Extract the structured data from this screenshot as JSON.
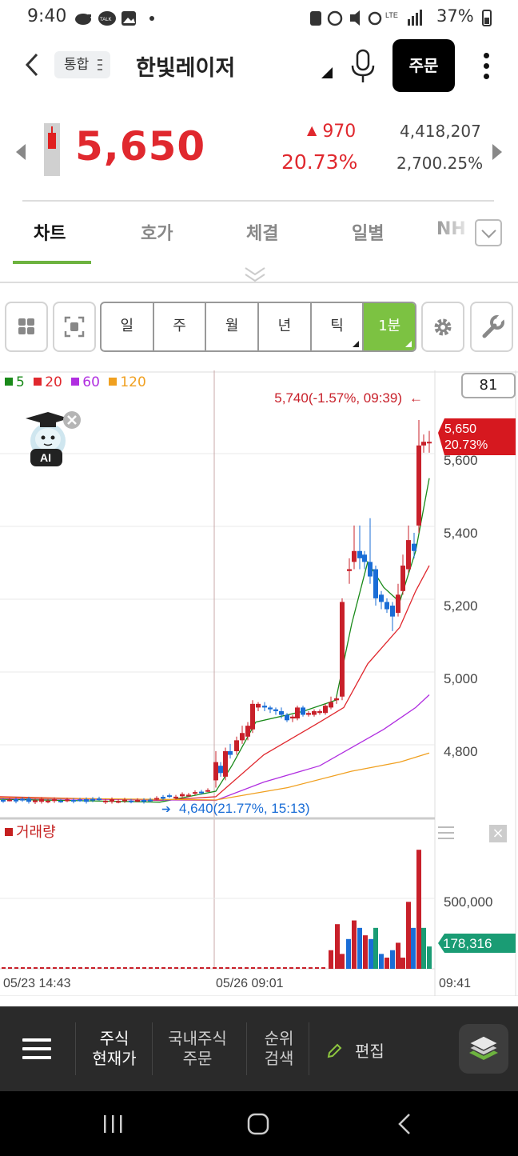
{
  "status_bar": {
    "time": "9:40",
    "left_icons": [
      "piggy-bank-icon",
      "kakaotalk-icon",
      "image-icon",
      "dot-icon"
    ],
    "talk_label": "TALK",
    "lte_label": "LTE",
    "battery": "37%"
  },
  "header": {
    "tag": "통합",
    "stock_name": "한빛레이저",
    "order_label": "주문"
  },
  "quote": {
    "price": "5,650",
    "change": "970",
    "change_pct": "20.73%",
    "volume": "4,418,207",
    "volume_pct": "2,700.25%"
  },
  "tabs": [
    {
      "label": "차트",
      "active": true
    },
    {
      "label": "호가"
    },
    {
      "label": "체결"
    },
    {
      "label": "일별"
    },
    {
      "label": "NH"
    }
  ],
  "toolbar": {
    "periods": [
      "일",
      "주",
      "월",
      "년",
      "틱",
      "1분"
    ],
    "selected": "1분"
  },
  "chart": {
    "legend": [
      {
        "label": "5",
        "color": "#1a8a1a"
      },
      {
        "label": "20",
        "color": "#e0282e"
      },
      {
        "label": "60",
        "color": "#b02ee0"
      },
      {
        "label": "120",
        "color": "#f0a020"
      }
    ],
    "ai_label": "AI",
    "count_box": "81",
    "high_marker": "5,740(-1.57%, 09:39)",
    "low_marker": "4,640(21.77%, 15:13)",
    "current_price": "5,650",
    "current_pct": "20.73%",
    "y_ticks": [
      "5,600",
      "5,400",
      "5,200",
      "5,000",
      "4,800"
    ],
    "volume_title": "거래량",
    "volume_tick": "500,000",
    "current_volume": "178,316",
    "x_labels": [
      "05/23 14:43",
      "05/26 09:01",
      "09:41"
    ]
  },
  "chart_data": {
    "type": "candlestick",
    "x": [
      "05/23 14:43",
      "05/26 09:01",
      "09:41"
    ],
    "y_range": [
      4640,
      5740
    ],
    "last_price": 5650,
    "high": 5740,
    "low": 4640,
    "series": [
      {
        "name": "5",
        "color": "#1a8a1a"
      },
      {
        "name": "20",
        "color": "#e0282e"
      },
      {
        "name": "60",
        "color": "#b02ee0"
      },
      {
        "name": "120",
        "color": "#f0a020"
      }
    ]
  },
  "bottom_nav": {
    "items": [
      {
        "line1": "주식",
        "line2": "현재가",
        "active": true
      },
      {
        "line1": "국내주식",
        "line2": "주문"
      },
      {
        "line1": "순위",
        "line2": "검색"
      }
    ],
    "edit_label": "편집"
  }
}
